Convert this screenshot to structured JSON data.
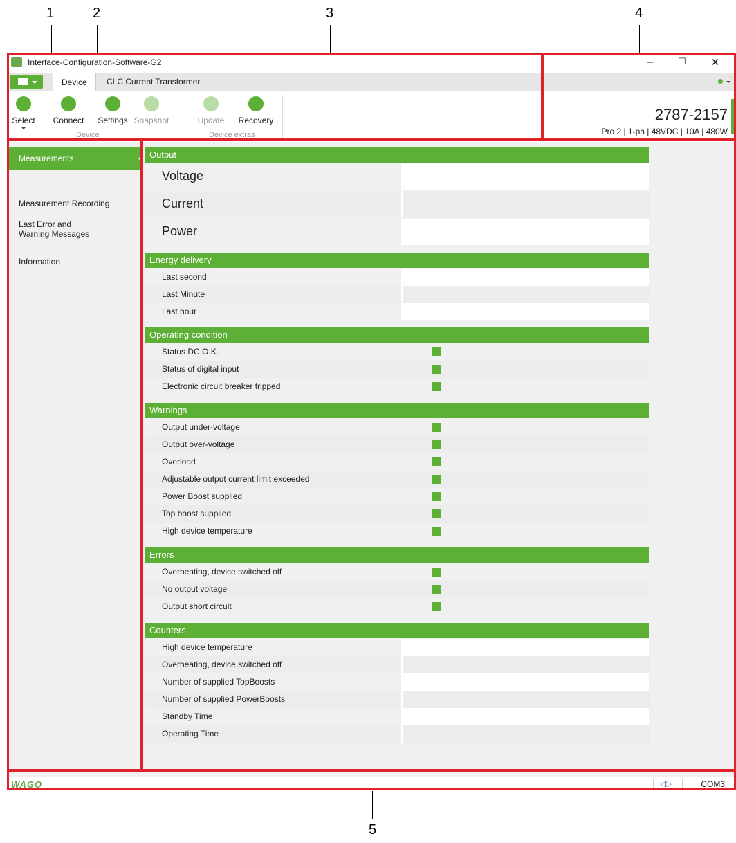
{
  "callouts": [
    "1",
    "2",
    "3",
    "4",
    "5"
  ],
  "window": {
    "title": "Interface-Configuration-Software-G2",
    "controls": {
      "minimize": "–",
      "maximize": "☐",
      "close": "✕"
    }
  },
  "ribbon": {
    "tabs": [
      "Device",
      "CLC Current Transformer"
    ],
    "buttons": [
      {
        "label": "Select",
        "icon": "hand-pointer-icon",
        "enabled": true
      },
      {
        "label": "Connect",
        "icon": "plug-connect-icon",
        "enabled": true
      },
      {
        "label": "Settings",
        "icon": "gear-icon",
        "enabled": true
      },
      {
        "label": "Snapshot",
        "icon": "snapshot-icon",
        "enabled": false
      },
      {
        "label": "Update",
        "icon": "update-icon",
        "enabled": false
      },
      {
        "label": "Recovery",
        "icon": "recovery-icon",
        "enabled": true
      }
    ],
    "groups": [
      "Device",
      "Device extras"
    ]
  },
  "device": {
    "article_prefix": "2787",
    "article_suffix": "-2157",
    "description": "Pro 2 | 1-ph | 48VDC | 10A | 480W"
  },
  "sidebar": {
    "items": [
      "Measurements",
      "Measurement Recording",
      "Last Error and Warning Messages",
      "Information"
    ]
  },
  "sections": {
    "output": {
      "title": "Output",
      "rows": [
        "Voltage",
        "Current",
        "Power"
      ]
    },
    "energy": {
      "title": "Energy delivery",
      "rows": [
        "Last second",
        "Last Minute",
        "Last hour"
      ]
    },
    "operating": {
      "title": "Operating condition",
      "rows": [
        "Status DC O.K.",
        "Status of digital input",
        "Electronic circuit breaker tripped"
      ]
    },
    "warnings": {
      "title": "Warnings",
      "rows": [
        "Output under-voltage",
        "Output over-voltage",
        "Overload",
        "Adjustable output current limit exceeded",
        "Power Boost supplied",
        "Top boost supplied",
        "High device temperature"
      ]
    },
    "errors": {
      "title": "Errors",
      "rows": [
        "Overheating, device switched off",
        "No output voltage",
        "Output short circuit"
      ]
    },
    "counters": {
      "title": "Counters",
      "rows": [
        "High device temperature",
        "Overheating, device switched off",
        "Number of supplied TopBoosts",
        "Number of supplied PowerBoosts",
        "Standby Time",
        "Operating Time"
      ]
    }
  },
  "statusbar": {
    "logo": "WAGO",
    "port": "COM3"
  },
  "colors": {
    "accent": "#5cb035",
    "highlight": "#e0202a"
  }
}
